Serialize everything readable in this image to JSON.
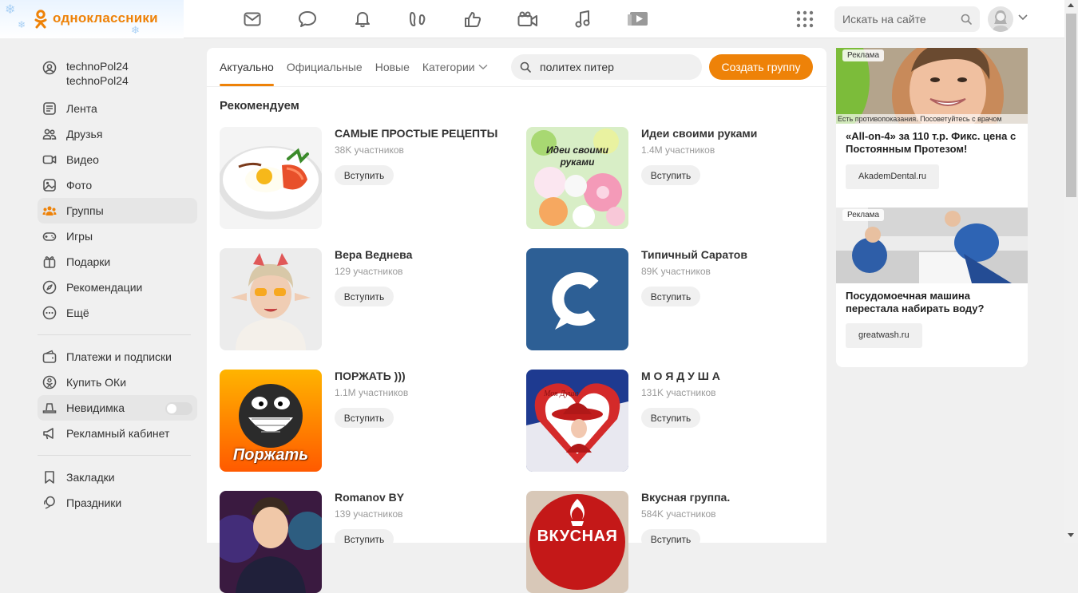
{
  "header": {
    "logo_text": "одноклассники",
    "search_placeholder": "Искать на сайте",
    "nav_icons": [
      "mail-icon",
      "chat-icon",
      "bell-icon",
      "guests-icon",
      "like-icon",
      "video-icon",
      "music-icon",
      "play-icon"
    ]
  },
  "sidebar": {
    "user_line1": "technoPol24",
    "user_line2": "technoPol24",
    "items": [
      {
        "label": "Лента",
        "icon": "feed-icon"
      },
      {
        "label": "Друзья",
        "icon": "friends-icon"
      },
      {
        "label": "Видео",
        "icon": "video-icon"
      },
      {
        "label": "Фото",
        "icon": "photo-icon"
      },
      {
        "label": "Группы",
        "icon": "groups-icon"
      },
      {
        "label": "Игры",
        "icon": "games-icon"
      },
      {
        "label": "Подарки",
        "icon": "gift-icon"
      },
      {
        "label": "Рекомендации",
        "icon": "compass-icon"
      },
      {
        "label": "Ещё",
        "icon": "more-icon"
      }
    ],
    "items2": [
      {
        "label": "Платежи и подписки",
        "icon": "wallet-icon"
      },
      {
        "label": "Купить ОКи",
        "icon": "coin-icon"
      },
      {
        "label": "Невидимка",
        "icon": "hat-icon"
      },
      {
        "label": "Рекламный кабинет",
        "icon": "megaphone-icon"
      }
    ],
    "items3": [
      {
        "label": "Закладки",
        "icon": "bookmark-icon"
      },
      {
        "label": "Праздники",
        "icon": "balloon-icon"
      }
    ]
  },
  "main": {
    "tabs": [
      {
        "label": "Актуально"
      },
      {
        "label": "Официальные"
      },
      {
        "label": "Новые"
      },
      {
        "label": "Категории"
      }
    ],
    "search_value": "политех питер",
    "create_label": "Создать группу",
    "section_title": "Рекомендуем",
    "join_label": "Вступить",
    "groups": [
      {
        "name": "САМЫЕ ПРОСТЫЕ РЕЦЕПТЫ",
        "count": "38K участников",
        "image_text": ""
      },
      {
        "name": "Идеи своими руками",
        "count": "1.4M участников",
        "image_text": "Идеи своими руками"
      },
      {
        "name": "Вера Веднева",
        "count": "129 участников",
        "image_text": ""
      },
      {
        "name": "Типичный Саратов",
        "count": "89K участников",
        "image_text": ""
      },
      {
        "name": "ПОРЖАТЬ )))",
        "count": "1.1M участников",
        "image_text": "Поржать"
      },
      {
        "name": "М О Я Д У Ш А",
        "count": "131K участников",
        "image_text": "Моя Душа"
      },
      {
        "name": "Romanov BY",
        "count": "139 участников",
        "image_text": ""
      },
      {
        "name": "Вкусная группа.",
        "count": "584K участников",
        "image_text": "ВКУСНАЯ"
      }
    ]
  },
  "ads": [
    {
      "tag": "Реклама",
      "note": "Есть противопоказания. Посоветуйтесь с врачом",
      "title": "«All-on-4» за 110 т.р. Фикс. цена с Постоянным Протезом!",
      "link": "AkademDental.ru"
    },
    {
      "tag": "Реклама",
      "note": "",
      "title": "Посудомоечная машина перестала набирать воду?",
      "link": "greatwash.ru"
    }
  ],
  "colors": {
    "accent": "#ee8208",
    "text": "#333333",
    "muted": "#999999",
    "bg": "#f0f0f0"
  }
}
